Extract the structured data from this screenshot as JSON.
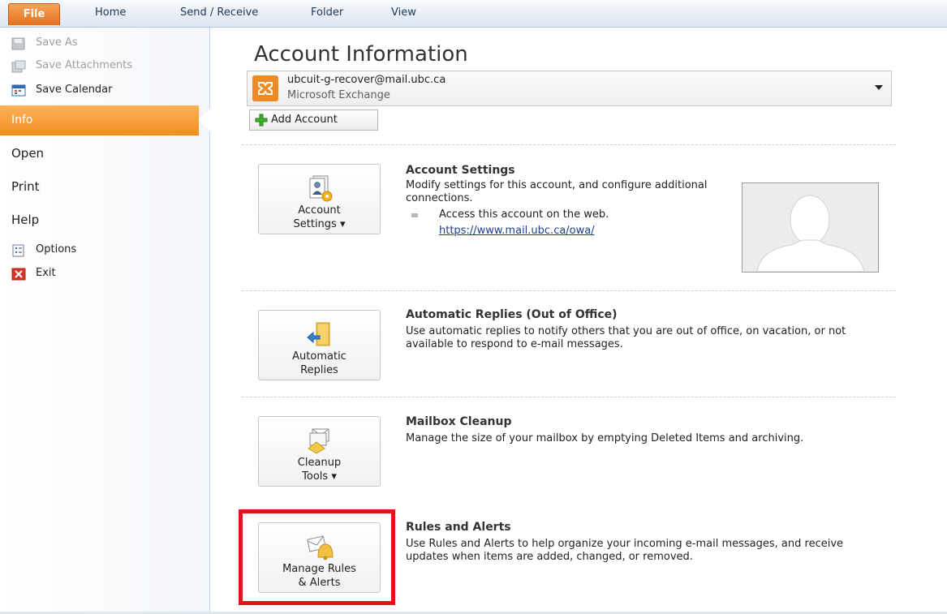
{
  "ribbon": {
    "tabs": [
      "File",
      "Home",
      "Send / Receive",
      "Folder",
      "View"
    ]
  },
  "nav": {
    "save_as": "Save As",
    "save_attachments": "Save Attachments",
    "save_calendar": "Save Calendar",
    "info": "Info",
    "open": "Open",
    "print": "Print",
    "help": "Help",
    "options": "Options",
    "exit": "Exit"
  },
  "main": {
    "title": "Account Information",
    "account": {
      "email": "ubcuit-g-recover@mail.ubc.ca",
      "type": "Microsoft Exchange"
    },
    "add_account": "Add Account",
    "sections": [
      {
        "button": [
          "Account",
          "Settings ▾"
        ],
        "title": "Account Settings",
        "description": "Modify settings for this account, and configure additional connections.",
        "bullet_text": "Access this account on the web.",
        "link": "https://www.mail.ubc.ca/owa/"
      },
      {
        "button": [
          "Automatic",
          "Replies"
        ],
        "title": "Automatic Replies (Out of Office)",
        "description": "Use automatic replies to notify others that you are out of office, on vacation, or not available to respond to e-mail messages."
      },
      {
        "button": [
          "Cleanup",
          "Tools ▾"
        ],
        "title": "Mailbox Cleanup",
        "description": "Manage the size of your mailbox by emptying Deleted Items and archiving."
      },
      {
        "button": [
          "Manage Rules",
          "& Alerts"
        ],
        "title": "Rules and Alerts",
        "description": "Use Rules and Alerts to help organize your incoming e-mail messages, and receive updates when items are added, changed, or removed."
      }
    ]
  },
  "colors": {
    "accent_orange": "#f28c20",
    "highlight_red": "#e0141c",
    "link_blue": "#1c3d8f"
  }
}
